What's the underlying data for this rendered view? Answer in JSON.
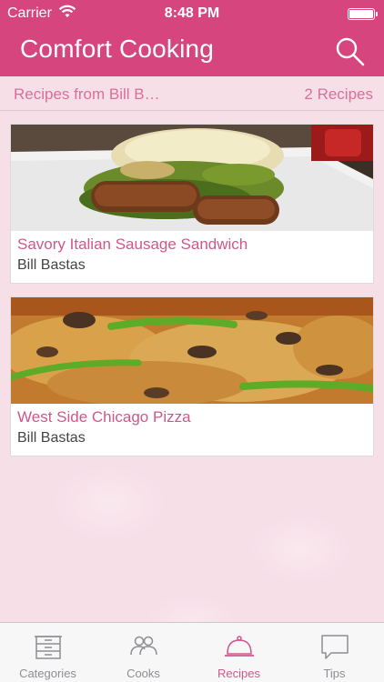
{
  "status_bar": {
    "carrier": "Carrier",
    "time": "8:48 PM"
  },
  "nav": {
    "title": "Comfort Cooking"
  },
  "subheader": {
    "left": "Recipes from Bill B…",
    "right": "2 Recipes"
  },
  "recipes": [
    {
      "name": "Savory Italian Sausage Sandwich",
      "cook": "Bill Bastas"
    },
    {
      "name": "West Side Chicago Pizza",
      "cook": "Bill Bastas"
    }
  ],
  "tabs": [
    {
      "label": "Categories"
    },
    {
      "label": "Cooks"
    },
    {
      "label": "Recipes"
    },
    {
      "label": "Tips"
    }
  ],
  "colors": {
    "brand": "#d6457e",
    "accent_text": "#d0578a",
    "tab_inactive": "#8e8e93"
  }
}
